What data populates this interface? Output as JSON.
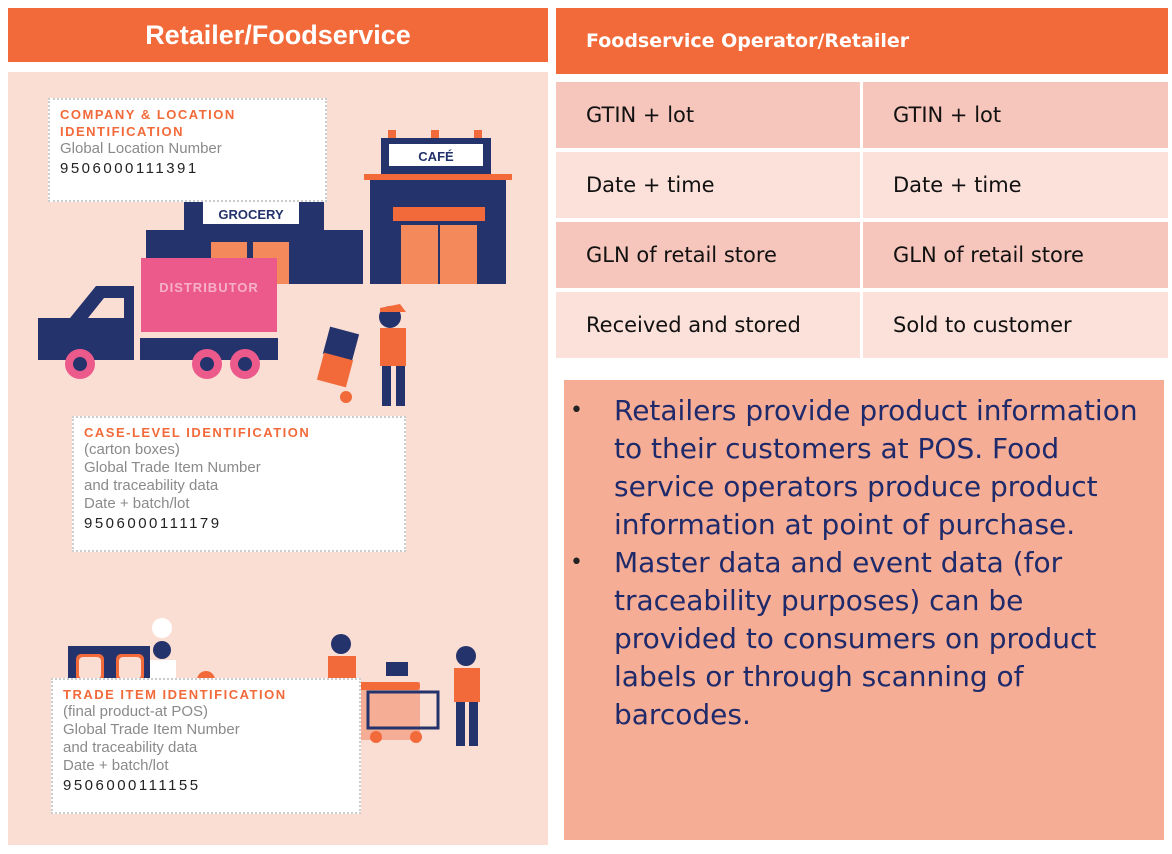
{
  "left": {
    "title": "Retailer/Foodservice",
    "illustration_labels": {
      "cafe": "CAFÉ",
      "grocery": "GROCERY",
      "distributor": "DISTRIBUTOR"
    },
    "cards": [
      {
        "title_lines": [
          "COMPANY & LOCATION",
          "IDENTIFICATION"
        ],
        "desc_lines": [
          "Global Location Number"
        ],
        "number": "9506000111391"
      },
      {
        "title_lines": [
          "CASE-LEVEL IDENTIFICATION"
        ],
        "desc_lines": [
          "(carton boxes)",
          "Global Trade Item Number",
          "and traceability data",
          "Date + batch/lot"
        ],
        "number": "9506000111179"
      },
      {
        "title_lines": [
          "TRADE ITEM IDENTIFICATION"
        ],
        "desc_lines": [
          "(final product-at POS)",
          "Global Trade Item Number",
          "and traceability data",
          "Date + batch/lot"
        ],
        "number": "9506000111155"
      }
    ]
  },
  "right": {
    "title": "Foodservice Operator/Retailer",
    "table": [
      [
        "GTIN + lot",
        "GTIN + lot"
      ],
      [
        "Date + time",
        "Date + time"
      ],
      [
        "GLN of retail store",
        "GLN of retail store"
      ],
      [
        "Received and stored",
        "Sold to customer"
      ]
    ],
    "bullets": [
      "Retailers provide product information to their customers at POS. Food service operators produce product information at point of purchase.",
      "Master data and event data (for traceability purposes) can be provided to consumers on product labels or through scanning of barcodes."
    ]
  },
  "colors": {
    "orange": "#f26a3a",
    "navy": "#24336b",
    "pink": "#ec5a8c",
    "panel": "#fbded3",
    "row_dark": "#f6c5bb",
    "row_light": "#fbe1d9",
    "bullet_box": "#f6ad95"
  }
}
